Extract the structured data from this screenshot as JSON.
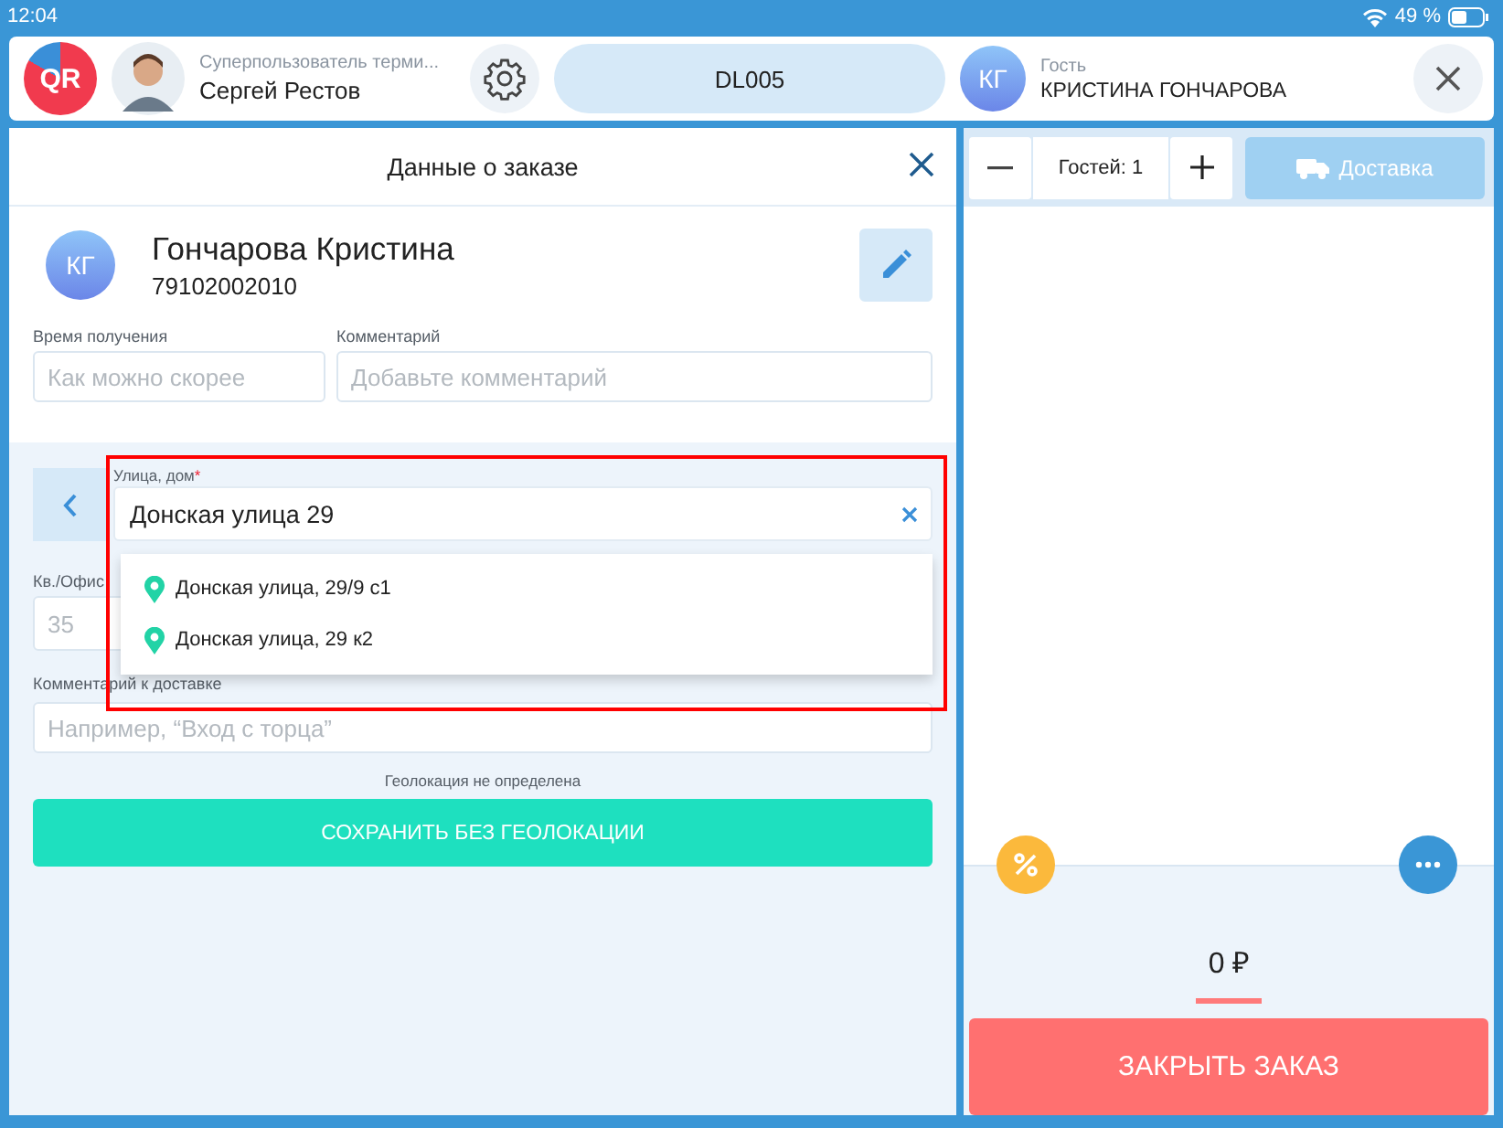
{
  "status_bar": {
    "time": "12:04",
    "battery": "49 %"
  },
  "header": {
    "logo_text": "QR",
    "user_role": "Суперпользователь терми...",
    "user_name": "Сергей Рестов",
    "order_code": "DL005",
    "guest_initials": "КГ",
    "guest_label": "Гость",
    "guest_name": "КРИСТИНА ГОНЧАРОВА"
  },
  "order_panel": {
    "title": "Данные о заказе",
    "customer": {
      "initials": "КГ",
      "name": "Гончарова Кристина",
      "phone": "79102002010"
    },
    "fields": [
      {
        "label": "Время получения",
        "placeholder": "Как можно скорее"
      },
      {
        "label": "Комментарий",
        "placeholder": "Добавьте комментарий"
      }
    ]
  },
  "address": {
    "street": {
      "label": "Улица, дом",
      "required_mark": "*",
      "value": "Донская улица 29"
    },
    "suggestions": [
      "Донская улица, 29/9 с1",
      "Донская улица, 29 к2"
    ],
    "apartment": {
      "label": "Кв./Офис",
      "placeholder": "35"
    },
    "delivery_comment": {
      "label": "Комментарий к доставке",
      "placeholder": "Например, “Вход с торца”"
    },
    "geo_status": "Геолокация не определена",
    "save_button": "СОХРАНИТЬ БЕЗ ГЕОЛОКАЦИИ"
  },
  "cart": {
    "guests": "Гостей: 1",
    "delivery_button": {
      "label": "Доставка",
      "disabled": true
    },
    "total": "0 ₽",
    "close_button": "ЗАКРЫТЬ ЗАКАЗ"
  }
}
